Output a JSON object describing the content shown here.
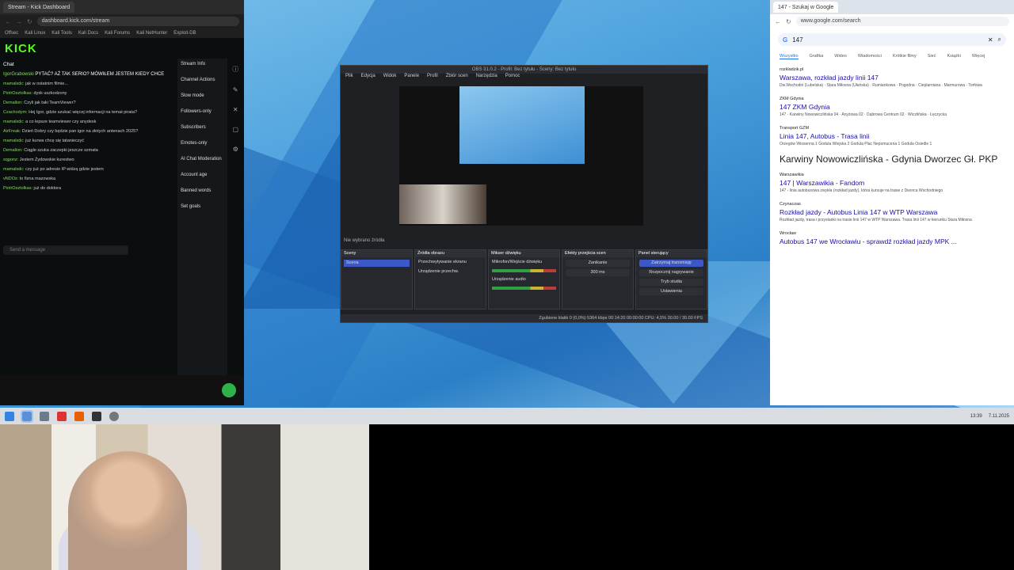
{
  "kick": {
    "tab_title": "Stream - Kick Dashboard",
    "url": "dashboard.kick.com/stream",
    "bookmarks": [
      "Offsec",
      "Kali Linux",
      "Kali Tools",
      "Kali Docs",
      "Kali Forums",
      "Kali NetHunter",
      "Exploit-DB"
    ],
    "logo": "KICK",
    "chat_title": "Chat",
    "pinned_user": "IgorGrabowski",
    "pinned_text": "PYTAĆ? AŻ TAK SERIO? MÓWIŁEM JESTEM KIEDY CHCE",
    "messages": [
      {
        "user": "mamalsdc:",
        "text": "jak w ostatnim filmie..."
      },
      {
        "user": "PiotrOsztolkas:",
        "text": "dysk uszkodzony"
      },
      {
        "user": "Demalion:",
        "text": "Czyli jak taki TeamViewer?"
      },
      {
        "user": "Czachodym:",
        "text": "Hej Igor, gdzie szukać więcej informacji na temat pirata?"
      },
      {
        "user": "mamalsdc:",
        "text": "a co lepsze teamviewer czy anydesk"
      },
      {
        "user": "AirFreak:",
        "text": "Dzień Dobry czy będzie pan igor na złotych antenach 2025?"
      },
      {
        "user": "mamalsdc:",
        "text": "już kurwa chcę się tatanieczyć"
      },
      {
        "user": "Demalion:",
        "text": "Ciągle szuka zaczepki jeszcze szmata"
      },
      {
        "user": "sqgonz:",
        "text": "Jestem Żydowskie kurestwo"
      },
      {
        "user": "mamalsdc:",
        "text": "czy już po adresie IP widzą gdzie jestem"
      },
      {
        "user": "vNDOz:",
        "text": "to fizna mazowska"
      },
      {
        "user": "PiotrOsztolkas:",
        "text": "już do doktora"
      }
    ],
    "chat_placeholder": "Send a message",
    "side_items": [
      "Stream Info",
      "Channel Actions",
      "Slow mode",
      "Followers-only",
      "Subscribers",
      "Emotes-only",
      "AI Chat Moderation",
      "Account age",
      "Banned words",
      "Set goals"
    ]
  },
  "obs": {
    "title": "OBS 31.0.2 - Profil: Bez tytułu - Sceny: Bez tytułu",
    "menu": [
      "Plik",
      "Edycja",
      "Widok",
      "Panele",
      "Profil",
      "Zbiór scen",
      "Narzędzia",
      "Pomoc"
    ],
    "no_source": "Nie wybrano źródła",
    "docks": [
      "Sceny",
      "Źródła obrazu",
      "Mikser dźwięku",
      "Efekty przejścia scen",
      "Panel sterujący"
    ],
    "scene": "Scena",
    "sources": [
      "Przechwytywanie ekranu",
      "Urządzenie przechw."
    ],
    "mixer": [
      "Mikrofon/Wejście dźwięku",
      "Urządzenie audio"
    ],
    "transition": "Zanikanie",
    "duration": "300 ms",
    "controls": [
      "Zatrzymaj transmisję",
      "Rozpocznij nagrywanie",
      "Tryb studia",
      "Ustawienia"
    ],
    "status": "Zgubione klatki 0 (0,0%)   5364 kbps   00:14:20   00:00:00   CPU: 4,5%   30.00 / 30.00 FPS"
  },
  "google": {
    "tab_title": "147 - Szukaj w Google",
    "url": "www.google.com/search",
    "query": "147",
    "tabs": [
      "Wszystko",
      "Grafika",
      "Wideo",
      "Wiadomości",
      "Krótkie filmy",
      "Sieć",
      "Książki",
      "Więcej"
    ],
    "results": [
      {
        "site": "rozkladzik.pl",
        "title": "Warszawa, rozkład jazdy linii 147",
        "snippet": "Dw.Wschodni (Lubelska) · Stara Miłosna (Ułańska) · Rumiankowa · Pogodna · Cieplarniana · Marmurowa · Torfowa"
      },
      {
        "site": "ZKM Gdynia",
        "title": "147 ZKM Gdynia",
        "snippet": "147 · Karwiny Nowowiczlińska 04 · Anyżowa 02 · Dąbrowa Centrum 02 · Wiczlińska · Łęczycka"
      },
      {
        "site": "Transport GZM",
        "title": "Linia 147, Autobus - Trasa linii",
        "snippet": "Orzegów Wiosenna 1 Godula Wiejska 2 Godula Plac Nepomucena 1 Godula Osiedle 1"
      }
    ],
    "headline": "Karwiny Nowowiczlińska - Gdynia Dworzec Gł. PKP",
    "results2": [
      {
        "site": "Warszawikia",
        "title": "147 | Warszawikia - Fandom",
        "snippet": "147 - linia autobusowa zwykła (rozkład jazdy), która kursuje na trasie z Dworca Wschodniego"
      },
      {
        "site": "Czynaczas",
        "title": "Rozkład jazdy - Autobus Linia 147 w WTP Warszawa",
        "snippet": "Rozkład jazdy, trasa i przystanki na trasie linii 147 w WTP Warszawa. Trasa linii 147 w kierunku Stara Miłosna"
      },
      {
        "site": "Wrocław",
        "title": "Autobus 147 we Wrocławiu - sprawdź rozkład jazdy MPK ...",
        "snippet": ""
      }
    ]
  },
  "taskbar": {
    "time": "13:39",
    "date": "7.11.2025"
  }
}
